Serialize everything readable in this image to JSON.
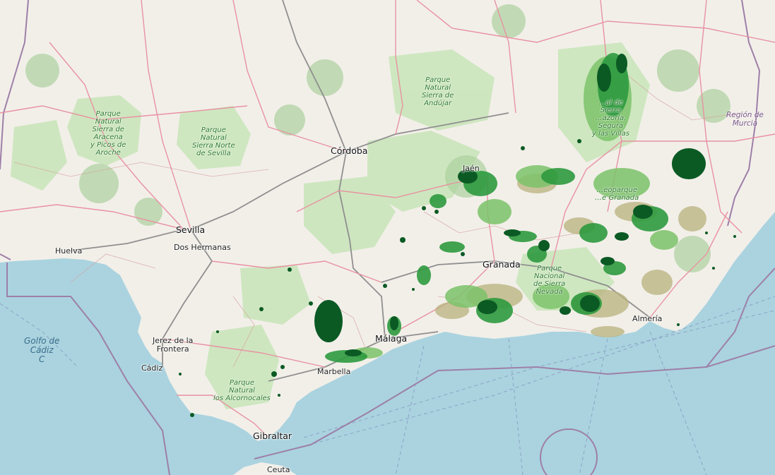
{
  "map": {
    "colors": {
      "land": "#f2efe9",
      "water": "#aad3df",
      "park_fill": "#c8e5b8",
      "forest": "#add19e",
      "road_primary": "#e892a2",
      "road_motorway": "#8f8f8f",
      "border": "#9e7fa8",
      "overlay_dark": "#0b5a24",
      "overlay_mid": "#2e9a3f",
      "overlay_light": "#7cc36a",
      "overlay_tan": "#b9b27e"
    },
    "cities": {
      "cordoba": "Córdoba",
      "sevilla": "Sevilla",
      "dos_hermanas": "Dos Hermanas",
      "huelva": "Huelva",
      "jaen": "Jaén",
      "granada": "Granada",
      "almeria": "Almería",
      "malaga": "Málaga",
      "marbella": "Marbella",
      "cadiz": "Cádiz",
      "jerez": "Jerez de la\nFrontera",
      "gibraltar": "Gibraltar",
      "ceuta": "Ceuta"
    },
    "parks": {
      "aracena": "Parque\nNatural\nSierra de\nAracena\ny Picos de\nAroche",
      "sevilla_norte": "Parque\nNatural\nSierra Norte\nde Sevilla",
      "andujar": "Parque\nNatural\nSierra de\nAndújar",
      "cazorla": "…al de\nSierra\n…azorla,\nSegura\ny las Villas",
      "sierra_nevada": "Parque\nNacional\nde Sierra\nNevada",
      "alcornocales": "Parque\nNatural\nlos Alcornocales",
      "granada_geo": "…eoparque\n…e Granada"
    },
    "regions": {
      "murcia": "Región de\nMurcia"
    },
    "seas": {
      "cadiz_gulf": "Golfo de\nCádiz\nC"
    }
  }
}
